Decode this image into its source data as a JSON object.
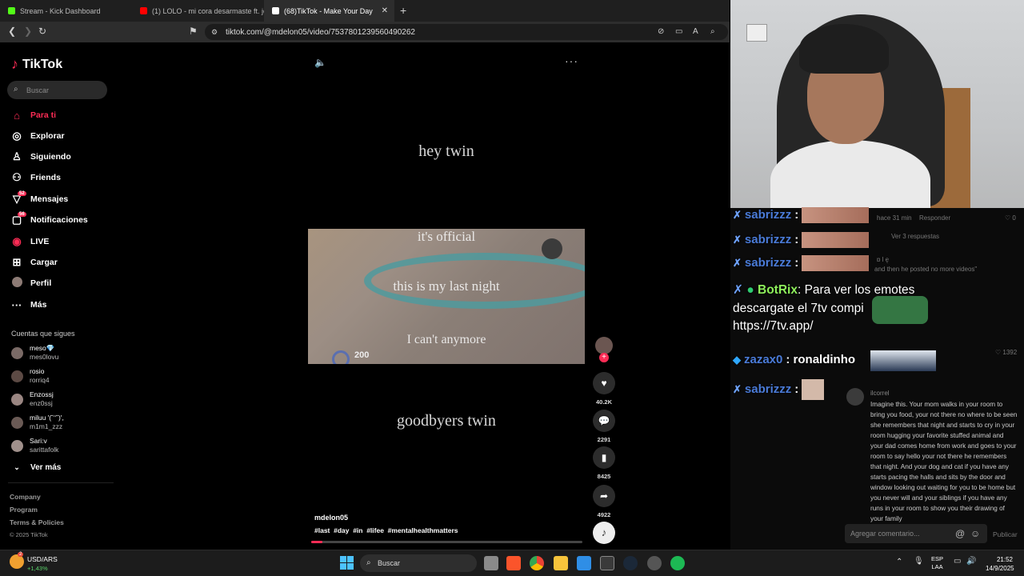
{
  "browser": {
    "tabs": [
      {
        "label": "Stream - Kick Dashboard",
        "active": false,
        "favicon_color": "#53fc18"
      },
      {
        "label": "(1) LOLO - mi cora desarmaste ft. jovi",
        "active": false,
        "favicon_color": "#ff0000"
      },
      {
        "label": "(68)TikTok - Make Your Day",
        "active": true,
        "favicon_color": "#ffffff"
      }
    ],
    "url": "tiktok.com/@mdelon05/video/7537801239560490262"
  },
  "tiktok": {
    "logo": "TikTok",
    "search_placeholder": "Buscar",
    "nav": [
      {
        "label": "Para ti",
        "icon": "home-icon",
        "active": true
      },
      {
        "label": "Explorar",
        "icon": "compass-icon"
      },
      {
        "label": "Siguiendo",
        "icon": "user-follow-icon"
      },
      {
        "label": "Friends",
        "icon": "friends-icon"
      },
      {
        "label": "Mensajes",
        "icon": "message-icon",
        "badge": "52"
      },
      {
        "label": "Notificaciones",
        "icon": "inbox-icon",
        "badge": "56"
      },
      {
        "label": "LIVE",
        "icon": "live-icon"
      },
      {
        "label": "Cargar",
        "icon": "upload-icon"
      },
      {
        "label": "Perfil",
        "icon": "profile-icon"
      },
      {
        "label": "Más",
        "icon": "more-icon"
      }
    ],
    "following_header": "Cuentas que sigues",
    "following": [
      {
        "name": "meso💎",
        "handle": "mes0lovu"
      },
      {
        "name": "rosio",
        "handle": "rorriq4"
      },
      {
        "name": "Enzossj",
        "handle": "enz0ssj"
      },
      {
        "name": "miluu '(˘ᵔ˘)',",
        "handle": "m1m1_zzz"
      },
      {
        "name": "Sari:v",
        "handle": "sarittafolk"
      }
    ],
    "see_more": "Ver más",
    "footer": [
      "Company",
      "Program",
      "Terms & Policies"
    ],
    "copyright": "© 2025 TikTok",
    "video": {
      "text_top": "hey twin",
      "clip_lines": [
        "it's official",
        "this is my last night",
        "I can't anymore"
      ],
      "score": "200",
      "text_bottom": "goodbyers twin",
      "author": "mdelon05",
      "hashtags": "#last  #day  #in  #lifee  #mentalhealthmatters",
      "progress": 0.04
    },
    "actions": {
      "likes": "40.2K",
      "comments": "2291",
      "saves": "8425",
      "shares": "4922"
    }
  },
  "overlay": {
    "chat": [
      {
        "user": "sabrizzz",
        "text": ":"
      },
      {
        "user": "sabrizzz",
        "text": ":"
      },
      {
        "user": "sabrizzz",
        "text": ":"
      },
      {
        "user": "BotRix",
        "text": ": Para ver los emotes descargate el 7tv compi https://7tv.app/"
      },
      {
        "user": "zazax0",
        "text": ": ronaldinho"
      },
      {
        "user": "sabrizzz",
        "text": ":"
      }
    ],
    "bg_comments": {
      "c1_time": "hace 31 min",
      "c1_reply": "Responder",
      "c1_likes": "0",
      "replies": "Ver 3 respuestas",
      "quote_user": "ɒ l ę",
      "quote": "and then he posted no more videos\"",
      "likes2": "1392",
      "comment_user": "ilcorrel",
      "comment": "Imagine this. Your mom walks in your room to bring you food, your not there no where to be seen she remembers that night and starts to cry in your room hugging your favorite stuffed animal and your dad comes home from work and goes to your room to say hello your not there he remembers that night. And your dog and cat if you have any starts pacing the halls and sits by the door and window looking out waiting for you to be home but you never will and your siblings if you have any runs in your room to show you their drawing of your family",
      "input_placeholder": "Agregar comentario...",
      "post": "Publicar"
    }
  },
  "taskbar": {
    "ticker_name": "USD/ARS",
    "ticker_change": "+1,43%",
    "ticker_badge": "2",
    "search": "Buscar",
    "lang1": "ESP",
    "lang2": "LAA",
    "time": "21:52",
    "date": "14/9/2025"
  },
  "colors": {
    "tiktok_red": "#fe2c55",
    "botrix_green": "#8ef05b",
    "user_blue": "#4a7bd8"
  }
}
